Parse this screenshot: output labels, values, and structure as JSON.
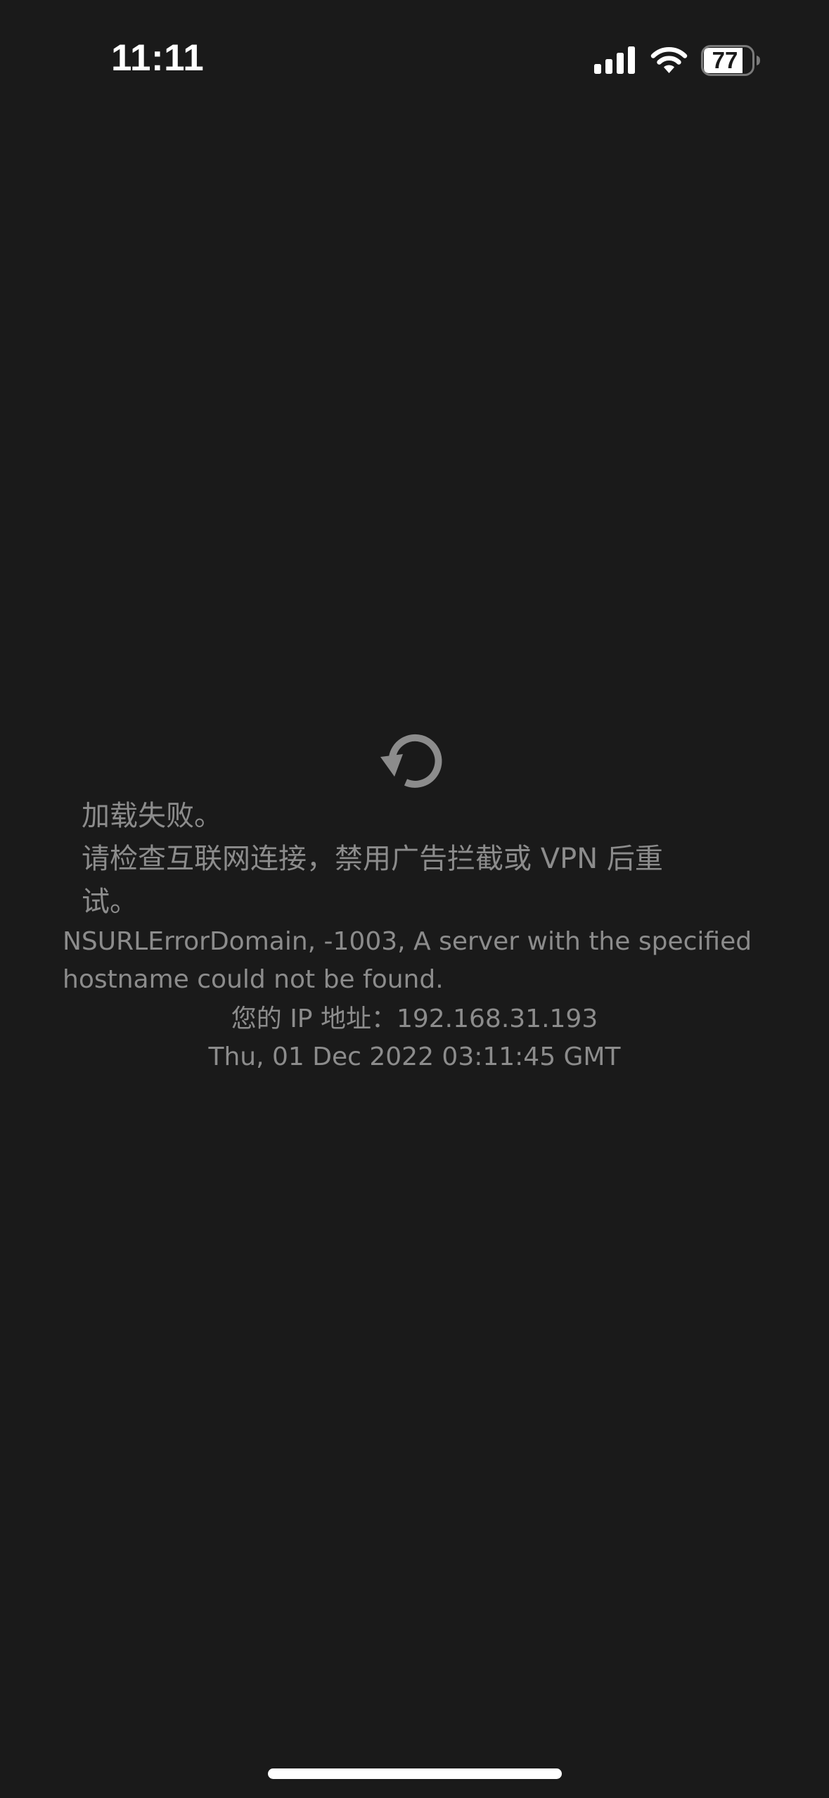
{
  "status_bar": {
    "time": "11:11",
    "battery_level": "77",
    "icons": [
      "signal-icon",
      "wifi-icon",
      "battery-icon"
    ]
  },
  "error": {
    "icon": "reload-icon",
    "title_lines": [
      "加载失败。",
      "请检查互联网连接，禁用广告拦截或 VPN 后重",
      "试。"
    ],
    "detail_lines": [
      "NSURLErrorDomain, -1003, A server with the specified",
      "hostname could not be found."
    ],
    "ip_line": "您的 IP 地址：192.168.31.193",
    "timestamp": "Thu, 01 Dec 2022 03:11:45 GMT"
  },
  "colors": {
    "background": "#1a1a1a",
    "text": "#8c8c8c",
    "icon": "#8c8c8c",
    "status_text": "#ffffff"
  }
}
